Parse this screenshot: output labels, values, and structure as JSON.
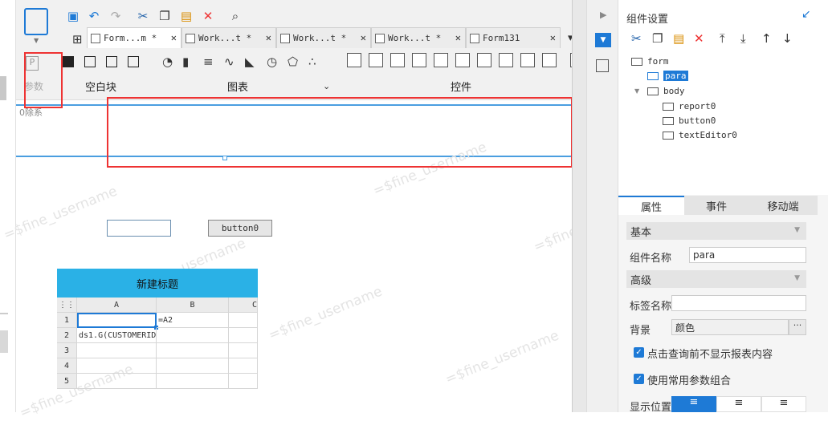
{
  "toolbar": {
    "tabs": [
      {
        "label": "Form...m *",
        "active": true
      },
      {
        "label": "Work...t *",
        "active": false
      },
      {
        "label": "Work...t *",
        "active": false
      },
      {
        "label": "Work...t *",
        "active": false
      },
      {
        "label": "Form131",
        "active": false
      }
    ],
    "param_label": "参数",
    "group_blank": "空白块",
    "group_chart": "图表",
    "group_widget": "控件"
  },
  "canvas": {
    "param_bar_label": "0除系",
    "button0_label": "button0",
    "report_title": "新建标题",
    "col_headers": [
      "A",
      "B",
      "C"
    ],
    "row_headers": [
      "1",
      "2",
      "3",
      "4",
      "5"
    ],
    "cell_b1": "=A2",
    "cell_a2": "ds1.G(CUSTOMERID",
    "watermark": "=$fine_username"
  },
  "panel": {
    "title": "组件设置",
    "tree": [
      "form",
      "para",
      "body",
      "report0",
      "button0",
      "textEditor0"
    ],
    "tabs": [
      "属性",
      "事件",
      "移动端"
    ],
    "section_basic": "基本",
    "widget_name_label": "组件名称",
    "widget_name_value": "para",
    "section_advanced": "高级",
    "tag_name_label": "标签名称",
    "tag_name_value": "",
    "bg_label": "背景",
    "bg_value": "颜色",
    "chk1": "点击查询前不显示报表内容",
    "chk2": "使用常用参数组合",
    "display_pos_label": "显示位置"
  },
  "colors": {
    "accent": "#1e7ad6",
    "report_header": "#2ab1e6",
    "highlight": "#e33"
  }
}
